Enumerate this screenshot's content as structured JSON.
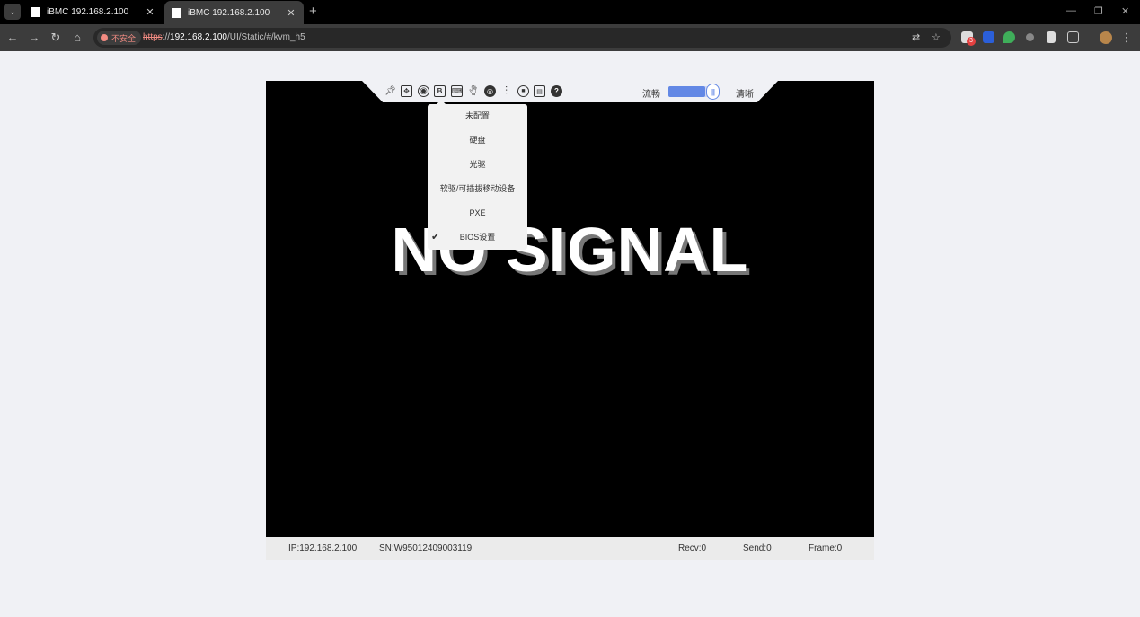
{
  "browser": {
    "tabs": [
      {
        "title": "iBMC 192.168.2.100",
        "close": "✕"
      },
      {
        "title": "iBMC 192.168.2.100",
        "close": "✕"
      }
    ],
    "new_tab": "+",
    "window_controls": {
      "minimize": "—",
      "restore": "❐",
      "close": "✕"
    },
    "nav": {
      "back": "←",
      "forward": "→",
      "reload": "↻",
      "home": "⌂"
    },
    "security_label": "不安全",
    "url": {
      "scheme": "https",
      "rest_prefix": "://",
      "host": "192.168.2.100",
      "path": "/UI/Static/#/kvm_h5"
    },
    "extension_badge": "3",
    "colors": {
      "insecure": "#f28b82",
      "accent": "#6388e5"
    }
  },
  "kvm_toolbar": {
    "icons": [
      "pin-icon",
      "fit-screen-icon",
      "power-icon",
      "boot-options-icon",
      "keyboard-icon",
      "mouse-icon",
      "media-icon",
      "usb-icon",
      "record-icon",
      "screenshot-icon",
      "help-icon"
    ],
    "quality_low_label": "流畅",
    "quality_high_label": "清晰",
    "quality_level": 0.75
  },
  "screen": {
    "no_signal_text": "NO SIGNAL"
  },
  "boot_menu": {
    "items": [
      {
        "label": "未配置",
        "checked": false
      },
      {
        "label": "硬盘",
        "checked": false
      },
      {
        "label": "光驱",
        "checked": false
      },
      {
        "label": "软驱/可插拔移动设备",
        "checked": false
      },
      {
        "label": "PXE",
        "checked": false
      },
      {
        "label": "BIOS设置",
        "checked": true
      }
    ],
    "check_mark": "✔"
  },
  "statusbar": {
    "ip": "IP:192.168.2.100",
    "sn": "SN:W95012409003119",
    "recv": "Recv:0",
    "send": "Send:0",
    "frame": "Frame:0"
  }
}
